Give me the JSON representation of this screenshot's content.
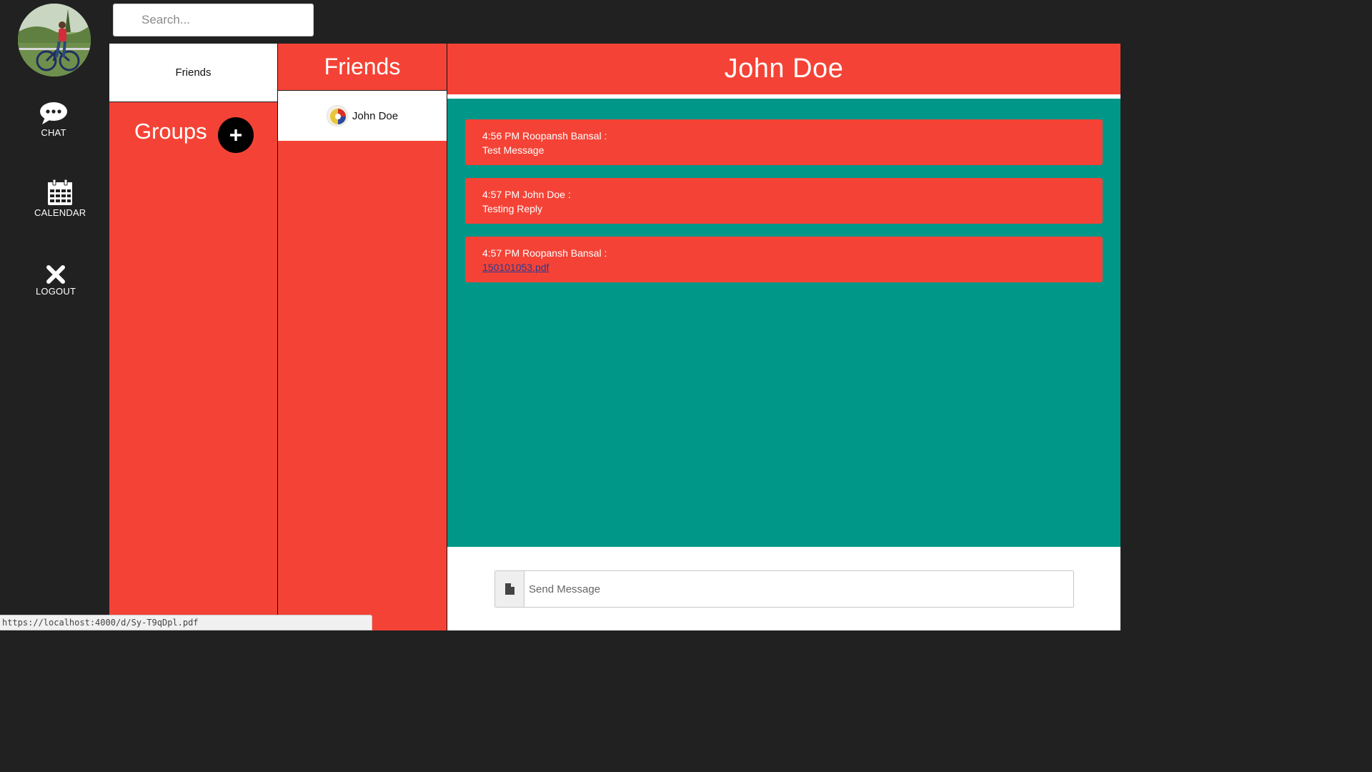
{
  "profile": {
    "avatar_icon": "user-photo"
  },
  "sidebar": {
    "items": [
      {
        "label": "CHAT",
        "icon": "chat-bubble-icon"
      },
      {
        "label": "CALENDAR",
        "icon": "calendar-icon"
      },
      {
        "label": "LOGOUT",
        "icon": "close-icon"
      }
    ]
  },
  "search": {
    "placeholder": "Search...",
    "value": ""
  },
  "tabs": {
    "friends_label": "Friends"
  },
  "groups": {
    "title": "Groups",
    "add_icon": "plus-icon"
  },
  "friends_list": {
    "title": "Friends",
    "items": [
      {
        "name": "John Doe",
        "avatar_icon": "contact-avatar"
      }
    ]
  },
  "chat": {
    "title": "John Doe",
    "messages": [
      {
        "meta": "4:56 PM Roopansh Bansal :",
        "text": "Test Message",
        "is_link": false
      },
      {
        "meta": "4:57 PM John Doe :",
        "text": "Testing Reply",
        "is_link": false
      },
      {
        "meta": "4:57 PM Roopansh Bansal :",
        "text": "150101053.pdf",
        "is_link": true
      }
    ]
  },
  "composer": {
    "placeholder": "Send Message",
    "value": "",
    "attach_icon": "file-icon"
  },
  "statusbar": {
    "url": "https://localhost:4000/d/Sy-T9qDpl.pdf"
  },
  "colors": {
    "accent_red": "#f44336",
    "teal": "#009688",
    "dark": "#212121"
  }
}
